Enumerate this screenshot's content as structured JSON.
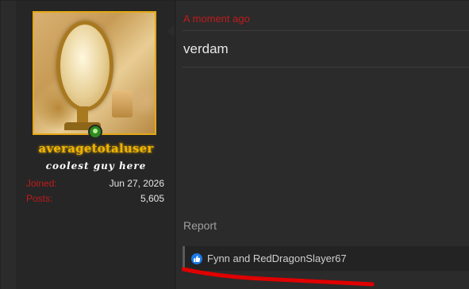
{
  "post": {
    "timestamp": "A moment ago",
    "message": "verdam",
    "report_label": "Report",
    "reactions": {
      "icon": "like-icon",
      "names": "Fynn and RedDragonSlayer67"
    }
  },
  "user": {
    "avatar_icon": "avatar",
    "online_status": "online-indicator",
    "username": "averagetotaluser",
    "title": "coolest guy here",
    "stats": [
      {
        "label": "Joined:",
        "value": "Jun 27, 2026"
      },
      {
        "label": "Posts:",
        "value": "5,605"
      }
    ]
  },
  "colors": {
    "background": "#2b2b2b",
    "username": "#f0b400",
    "accent_red": "#c01b1b",
    "like_blue": "#1a78e6"
  }
}
